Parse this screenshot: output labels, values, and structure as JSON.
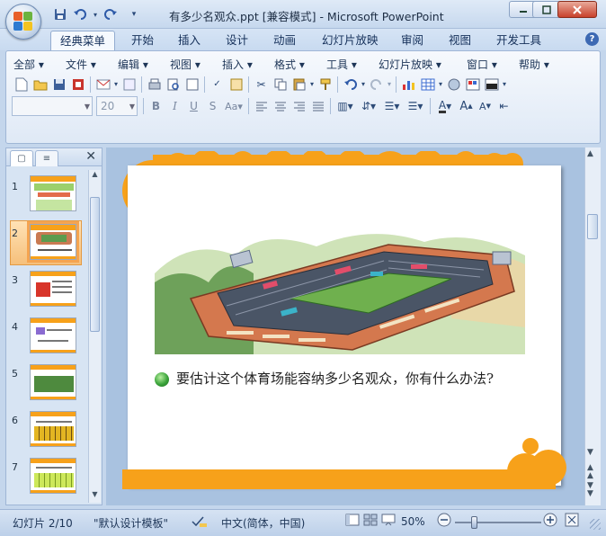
{
  "window": {
    "title": "有多少名观众.ppt [兼容模式] - Microsoft PowerPoint"
  },
  "quick_access": {
    "icons": [
      "save-icon",
      "undo-icon",
      "redo-icon",
      "customize-icon"
    ]
  },
  "ribbon_tabs": [
    {
      "label": "经典菜单",
      "active": true
    },
    {
      "label": "开始"
    },
    {
      "label": "插入"
    },
    {
      "label": "设计"
    },
    {
      "label": "动画"
    },
    {
      "label": "幻灯片放映"
    },
    {
      "label": "审阅"
    },
    {
      "label": "视图"
    },
    {
      "label": "开发工具"
    }
  ],
  "menu_bar": [
    {
      "label": "全部"
    },
    {
      "label": "文件"
    },
    {
      "label": "编辑"
    },
    {
      "label": "视图"
    },
    {
      "label": "插入"
    },
    {
      "label": "格式"
    },
    {
      "label": "工具"
    },
    {
      "label": "幻灯片放映"
    },
    {
      "label": "窗口"
    },
    {
      "label": "帮助"
    }
  ],
  "font_controls": {
    "font_name": "",
    "font_size": "20"
  },
  "slides": [
    {
      "number": "1"
    },
    {
      "number": "2",
      "selected": true
    },
    {
      "number": "3"
    },
    {
      "number": "4"
    },
    {
      "number": "5"
    },
    {
      "number": "6"
    },
    {
      "number": "7"
    }
  ],
  "slide_content": {
    "question": "要估计这个体育场能容纳多少名观众，你有什么办法?"
  },
  "status_bar": {
    "slide_info": "幻灯片 2/10",
    "theme": "\"默认设计模板\"",
    "language": "中文(简体，中国)",
    "zoom": "50%"
  },
  "colors": {
    "accent_orange": "#f7a11a",
    "ribbon_blue": "#c6d8ee"
  }
}
